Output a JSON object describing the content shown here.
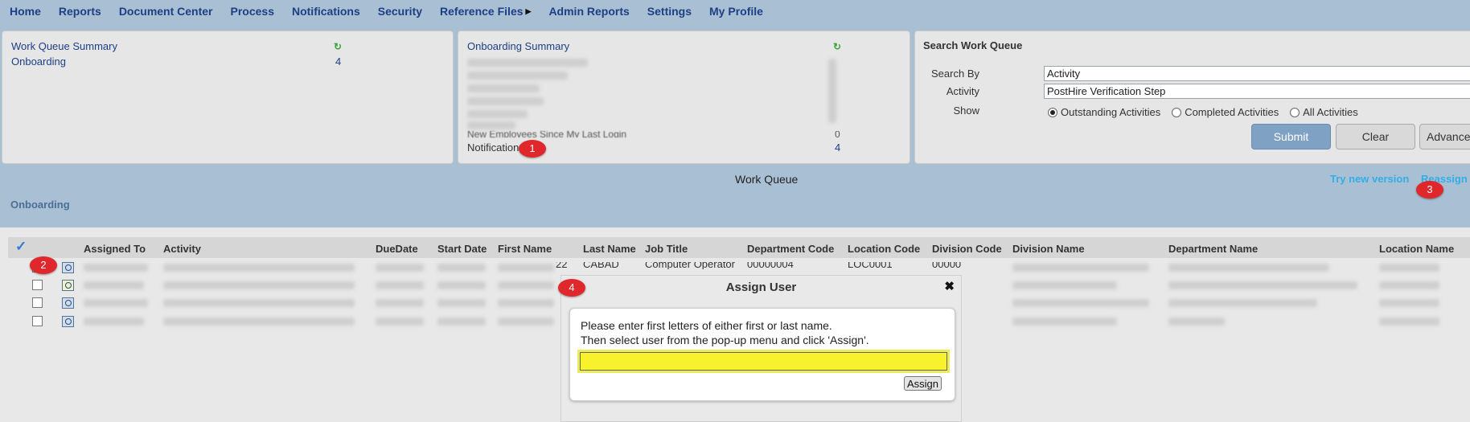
{
  "nav": {
    "items": [
      "Home",
      "Reports",
      "Document Center",
      "Process",
      "Notifications",
      "Security",
      "Reference Files",
      "Admin Reports",
      "Settings",
      "My Profile"
    ]
  },
  "work_queue_summary": {
    "title": "Work Queue Summary",
    "rows": [
      {
        "label": "Onboarding",
        "count": "4"
      }
    ]
  },
  "onboarding_summary": {
    "title": "Onboarding Summary",
    "partial_row": "New Employees Since My Last Login",
    "partial_count": "0",
    "last_row": {
      "label": "Notifications",
      "count": "4"
    }
  },
  "search": {
    "title": "Search Work Queue",
    "search_by_label": "Search By",
    "search_by_value": "Activity",
    "activity_label": "Activity",
    "activity_value": "PostHire Verification Step",
    "show_label": "Show",
    "options": [
      "Outstanding Activities",
      "Completed Activities",
      "All Activities"
    ],
    "selected_option": 0,
    "submit": "Submit",
    "clear": "Clear",
    "advanced": "Advanced"
  },
  "work_queue": {
    "title": "Work Queue",
    "try_new": "Try new version",
    "reassign": "Reassign",
    "section": "Onboarding"
  },
  "table": {
    "headers": [
      "Assigned To",
      "Activity",
      "DueDate",
      "Start Date",
      "First Name",
      "Last Name",
      "Job Title",
      "Department Code",
      "Location Code",
      "Division Code",
      "Division Name",
      "Department Name",
      "Location Name"
    ],
    "visible_cells": {
      "row1_last_name": "CABAD",
      "row1_job_title": "Computer Operator",
      "row1_dept_code": "00000004",
      "row1_loc_code": "LOC0001",
      "row1_div_code": "00000",
      "row1_first_partial": "22"
    }
  },
  "badges": [
    "1",
    "2",
    "3",
    "4"
  ],
  "modal": {
    "title": "Assign User",
    "line1": "Please enter first letters of either first or last name.",
    "line2": "Then select user from the pop-up menu and click 'Assign'.",
    "input_value": "",
    "button": "Assign"
  },
  "colors": {
    "nav_text": "#1d3f86",
    "accent_link": "#33aee6",
    "badge": "#e0282c",
    "submit_bg": "#7fa1c3",
    "input_highlight": "#f7f22b"
  }
}
